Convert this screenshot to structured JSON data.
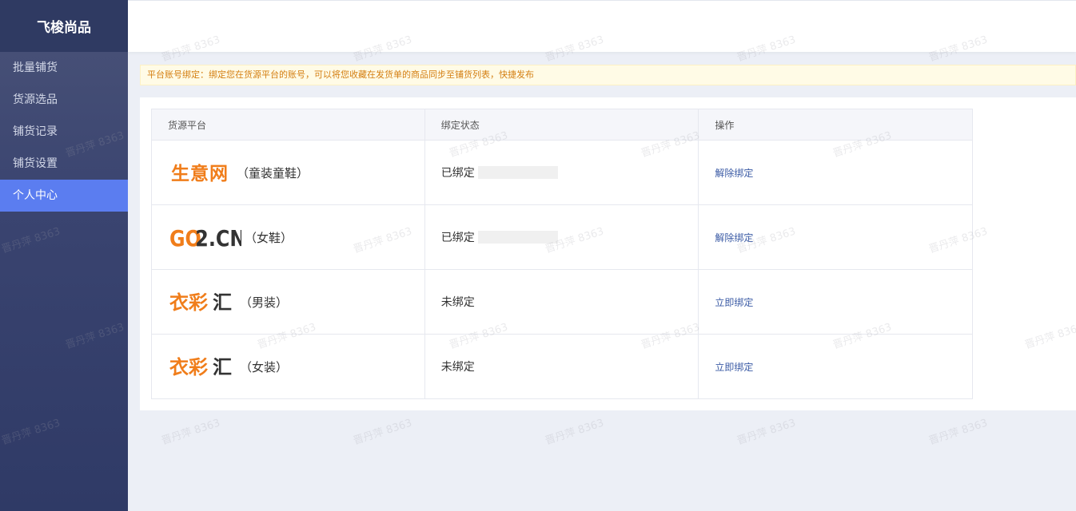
{
  "sidebar": {
    "brand": "飞梭尚品",
    "items": [
      {
        "label": "批量铺货",
        "active": false
      },
      {
        "label": "货源选品",
        "active": false
      },
      {
        "label": "铺货记录",
        "active": false
      },
      {
        "label": "铺货设置",
        "active": false
      },
      {
        "label": "个人中心",
        "active": true
      }
    ]
  },
  "notice": "平台账号绑定：绑定您在货源平台的账号，可以将您收藏在发货单的商品同步至铺货列表，快捷发布",
  "table": {
    "headers": [
      "货源平台",
      "绑定状态",
      "操作"
    ],
    "rows": [
      {
        "logo": "生意网",
        "suffix": "（童装童鞋）",
        "status": "已绑定",
        "masked": true,
        "action": "解除绑定"
      },
      {
        "logo": "GO2.CN",
        "suffix": "（女鞋）",
        "status": "已绑定",
        "masked": true,
        "action": "解除绑定"
      },
      {
        "logo": "衣彩汇",
        "suffix": "（男装）",
        "status": "未绑定",
        "masked": false,
        "action": "立即绑定"
      },
      {
        "logo": "衣彩汇",
        "suffix": "（女装）",
        "status": "未绑定",
        "masked": false,
        "action": "立即绑定"
      }
    ]
  },
  "watermark": "晋丹萍 8363",
  "colors": {
    "accent": "#5b7df0",
    "logo_orange": "#f07d1a",
    "logo_gray": "#333333",
    "notice_text": "#d47f12",
    "link": "#3b5ba5"
  }
}
